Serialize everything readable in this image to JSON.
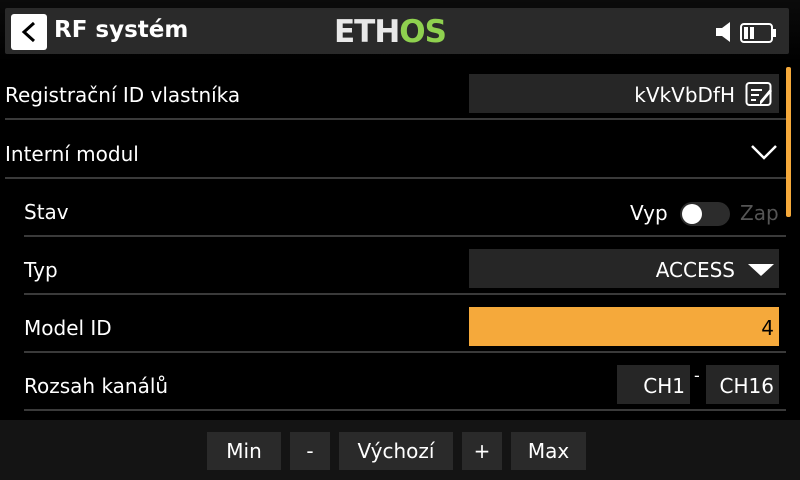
{
  "header": {
    "title": "RF systém",
    "logo_part1": "ETH",
    "logo_part2": "OS"
  },
  "rows": {
    "owner_id": {
      "label": "Registrační ID vlastníka",
      "value": "kVkVbDfH"
    },
    "internal_module": {
      "label": "Interní modul"
    },
    "state": {
      "label": "Stav",
      "off_label": "Vyp",
      "on_label": "Zap",
      "enabled": false
    },
    "type": {
      "label": "Typ",
      "value": "ACCESS"
    },
    "model_id": {
      "label": "Model ID",
      "value": "4"
    },
    "channel_range": {
      "label": "Rozsah kanálů",
      "start": "CH1",
      "separator": "-",
      "end": "CH16"
    }
  },
  "footer": {
    "min": "Min",
    "minus": "-",
    "default": "Výchozí",
    "plus": "+",
    "max": "Max"
  },
  "colors": {
    "accent": "#f5a93b",
    "logo_green": "#8fd14f",
    "field_bg": "#262626"
  }
}
